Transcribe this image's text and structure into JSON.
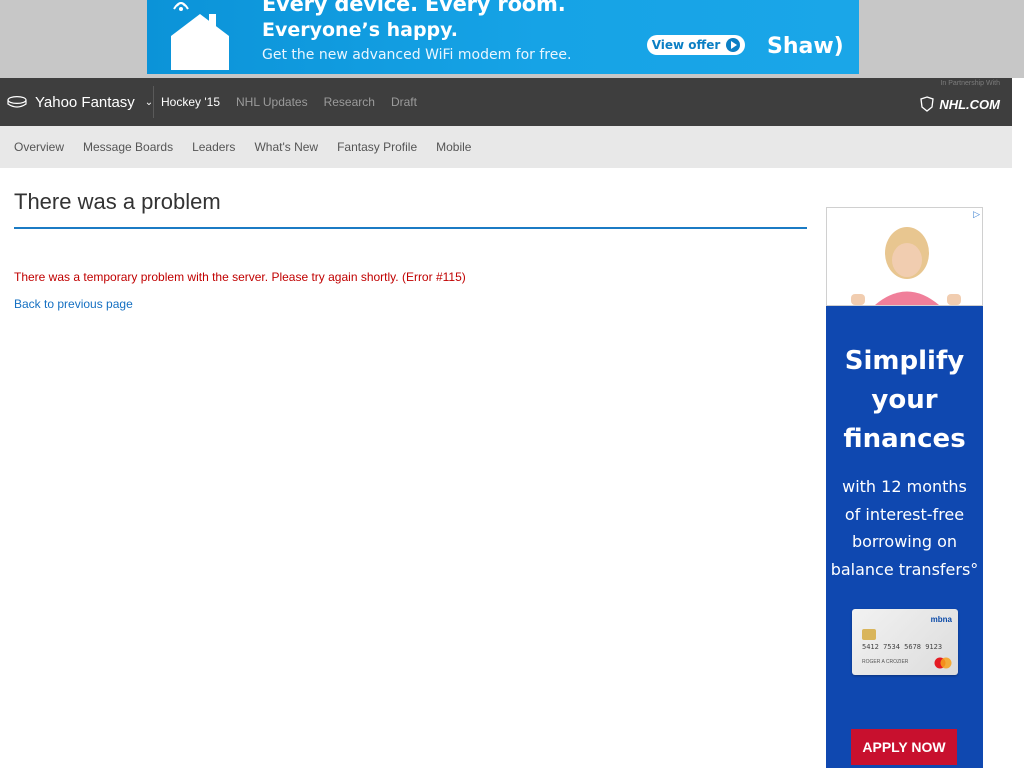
{
  "banner": {
    "line1": "Every device. Every room.",
    "line2": "Everyone’s happy.",
    "line3": "Get the new advanced WiFi modem for free.",
    "offer_button": "View offer",
    "brand": "Shaw)"
  },
  "top_nav": {
    "app_name": "Yahoo Fantasy",
    "links": [
      {
        "label": "Hockey '15",
        "active": true
      },
      {
        "label": "NHL Updates",
        "active": false
      },
      {
        "label": "Research",
        "active": false
      },
      {
        "label": "Draft",
        "active": false
      }
    ],
    "partner_text": "In Partnership With",
    "partner_brand": "NHL.COM"
  },
  "sub_nav": {
    "links": [
      "Overview",
      "Message Boards",
      "Leaders",
      "What's New",
      "Fantasy Profile",
      "Mobile"
    ]
  },
  "main": {
    "title": "There was a problem",
    "error": "There was a temporary problem with the server. Please try again shortly. (Error #115)",
    "back_link": "Back to previous page"
  },
  "side_ad": {
    "headline": [
      "Simplify",
      "your",
      "finances"
    ],
    "body": [
      "with 12 months",
      "of interest-free",
      "borrowing on",
      "balance transfers°"
    ],
    "card_issuer": "mbna",
    "card_number": "5412 7534 5678 9123",
    "card_holder": "ROGER A CROZIER",
    "apply_button": "APPLY NOW"
  },
  "colors": {
    "accent_blue": "#1b7bc4",
    "error_red": "#c00000",
    "link_blue": "#1570c2",
    "nav_dark": "#3e3e3e",
    "ad_blue": "#0f48b0",
    "apply_red": "#c8102e"
  },
  "icons": [
    "house-icon",
    "puck-icon",
    "chevron-down-icon",
    "play-icon",
    "nhl-shield-icon",
    "adchoices-icon"
  ]
}
